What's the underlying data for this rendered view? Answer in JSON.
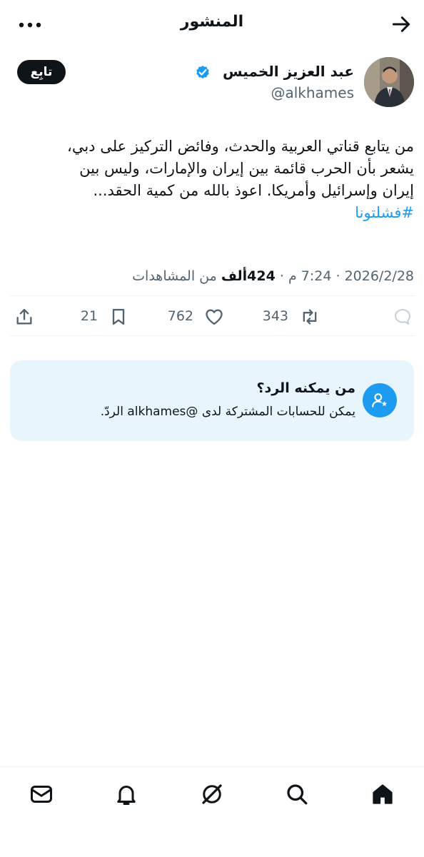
{
  "header": {
    "title": "المنشور",
    "back_icon": "arrow-back-icon",
    "more_icon": "more-horizontal-icon"
  },
  "author": {
    "name": "عبد العزيز الخميس",
    "handle": "@alkhames",
    "verified": true,
    "follow_label": "تابِع"
  },
  "post": {
    "lines": [
      "من يتابع قناتي العربية والحدث، وفائض التركيز على دبي،",
      "يشعر بأن الحرب قائمة بين إيران والإمارات، وليس بين",
      "إيران وإسرائيل وأمريكا.  اعوذ بالله من كمية الحقد..."
    ],
    "hashtag": "#فشلتونا"
  },
  "meta": {
    "date": "2026/2/28",
    "separator": "·",
    "time": "7:24 م",
    "views_count": "424ألف",
    "views_label": "من المشاهدات"
  },
  "actions": {
    "retweets": "343",
    "likes": "762",
    "bookmarks": "21",
    "icons": [
      "reply-icon",
      "retweet-icon",
      "like-icon",
      "bookmark-icon",
      "share-icon"
    ]
  },
  "reply_restriction": {
    "title": "من يمكنه الرد؟",
    "description": "يمكن للحسابات المشتركة لدى @alkhames الردّ."
  },
  "bottom_nav": {
    "items": [
      "home-icon",
      "search-icon",
      "grok-icon",
      "notifications-icon",
      "messages-icon"
    ]
  },
  "colors": {
    "accent": "#1d9bf0",
    "text": "#0f1419",
    "secondary": "#536471",
    "reply_box_bg": "#e8f5fd"
  }
}
